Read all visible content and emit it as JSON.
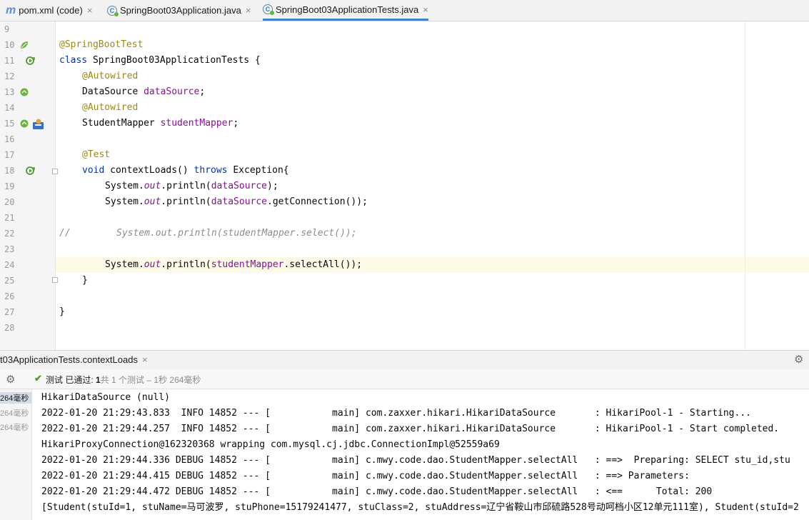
{
  "tabs": [
    {
      "label": "pom.xml (code)",
      "icon": "maven-m-icon",
      "active": false
    },
    {
      "label": "SpringBoot03Application.java",
      "icon": "spring-class-icon",
      "active": false
    },
    {
      "label": "SpringBoot03ApplicationTests.java",
      "icon": "spring-class-icon",
      "active": true
    }
  ],
  "close_glyph": "×",
  "editor": {
    "line_numbers": [
      "9",
      "10",
      "11",
      "12",
      "13",
      "14",
      "15",
      "16",
      "17",
      "18",
      "19",
      "20",
      "21",
      "22",
      "23",
      "24",
      "25",
      "26",
      "27",
      "28"
    ],
    "current_line": "24",
    "code": {
      "l10_ann": "@SpringBootTest",
      "l11_kw": "class",
      "l11_rest": " SpringBoot03ApplicationTests {",
      "l12_ann": "@Autowired",
      "l13_type": "DataSource ",
      "l13_field": "dataSource",
      "l13_end": ";",
      "l14_ann": "@Autowired",
      "l15_type": "StudentMapper ",
      "l15_field": "studentMapper",
      "l15_end": ";",
      "l17_ann": "@Test",
      "l18_kw1": "void",
      "l18_mid": " contextLoads() ",
      "l18_kw2": "throws",
      "l18_end": " Exception{",
      "l19_a": "System.",
      "l19_b": "out",
      "l19_c": ".println(",
      "l19_d": "dataSource",
      "l19_e": ");",
      "l20_a": "System.",
      "l20_b": "out",
      "l20_c": ".println(",
      "l20_d": "dataSource",
      "l20_e": ".getConnection());",
      "l22_slash": "//",
      "l22_comment": "System.out.println(studentMapper.select());",
      "l24_a": "System.",
      "l24_b": "out",
      "l24_c": ".println(",
      "l24_d": "studentMapper",
      "l24_e": ".selectAll());",
      "l25": "}",
      "l27": "}"
    }
  },
  "run_panel": {
    "tab_label": "t03ApplicationTests.contextLoads",
    "status_prefix": "测试 已通过: ",
    "status_count": "1",
    "status_suffix": "共 1 个测试 – 1秒 264毫秒",
    "tree_items": [
      "264毫秒",
      "264毫秒",
      "264毫秒"
    ]
  },
  "console_lines": [
    "HikariDataSource (null)",
    "2022-01-20 21:29:43.833  INFO 14852 --- [           main] com.zaxxer.hikari.HikariDataSource       : HikariPool-1 - Starting...",
    "2022-01-20 21:29:44.257  INFO 14852 --- [           main] com.zaxxer.hikari.HikariDataSource       : HikariPool-1 - Start completed.",
    "HikariProxyConnection@162320368 wrapping com.mysql.cj.jdbc.ConnectionImpl@52559a69",
    "2022-01-20 21:29:44.336 DEBUG 14852 --- [           main] c.mwy.code.dao.StudentMapper.selectAll   : ==>  Preparing: SELECT stu_id,stu",
    "2022-01-20 21:29:44.415 DEBUG 14852 --- [           main] c.mwy.code.dao.StudentMapper.selectAll   : ==> Parameters: ",
    "2022-01-20 21:29:44.472 DEBUG 14852 --- [           main] c.mwy.code.dao.StudentMapper.selectAll   : <==      Total: 200",
    "[Student(stuId=1, stuName=马可波罗, stuPhone=15179241477, stuClass=2, stuAddress=辽宁省鞍山市邱硫路528号动呵档小区12单元111室), Student(stuId=2"
  ]
}
